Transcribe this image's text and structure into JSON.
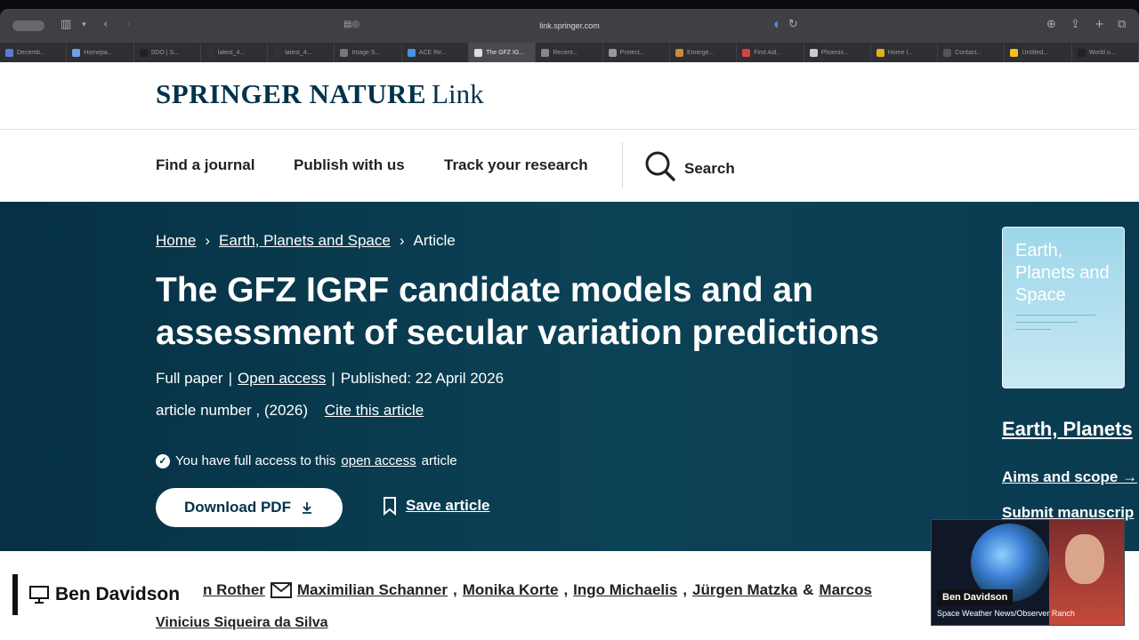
{
  "browser": {
    "url": "link.springer.com",
    "tabs": [
      "Decemb...",
      "Homepa...",
      "SDO | S...",
      "latest_4...",
      "latest_4...",
      "Image S...",
      "ACE Re...",
      "The GFZ IG...",
      "Recent...",
      "Protect...",
      "Emerge...",
      "First Aid...",
      "Phoenix...",
      "Home l...",
      "Contact...",
      "Untitled...",
      "World o..."
    ],
    "active_tab": 7
  },
  "site": {
    "logo_bold": "SPRINGER NATURE",
    "logo_light": "Link",
    "nav": [
      "Find a journal",
      "Publish with us",
      "Track your research"
    ],
    "search_label": "Search"
  },
  "article": {
    "breadcrumbs": [
      "Home",
      "Earth, Planets and Space",
      "Article"
    ],
    "title": "The GFZ IGRF candidate models and an assessment of secular variation predictions",
    "type": "Full paper",
    "open_access": "Open access",
    "published": "Published: 22 April 2026",
    "article_number": "article number , (2026)",
    "cite": "Cite this article",
    "access_pre": "You have full access to this",
    "access_link": "open access",
    "access_post": "article",
    "download": "Download PDF",
    "save": "Save article",
    "authors_partial": "n Rother",
    "authors": [
      "Maximilian Schanner",
      "Monika Korte",
      "Ingo Michaelis",
      "Jürgen Matzka"
    ],
    "authors_amp": "&",
    "authors_last": "Marcos",
    "authors_line2": "Vinicius Siqueira da Silva"
  },
  "sidebar": {
    "cover_title": "Earth, Planets and Space",
    "journal": "Earth, Planets",
    "aims": "Aims and scope",
    "submit": "Submit manuscrip"
  },
  "overlay": {
    "lower_third": "Ben Davidson",
    "cam_name": "Ben Davidson",
    "cam_sub": "Space Weather News/Observer Ranch"
  },
  "colors": {
    "brand": "#01324b",
    "hero": "#063044"
  }
}
